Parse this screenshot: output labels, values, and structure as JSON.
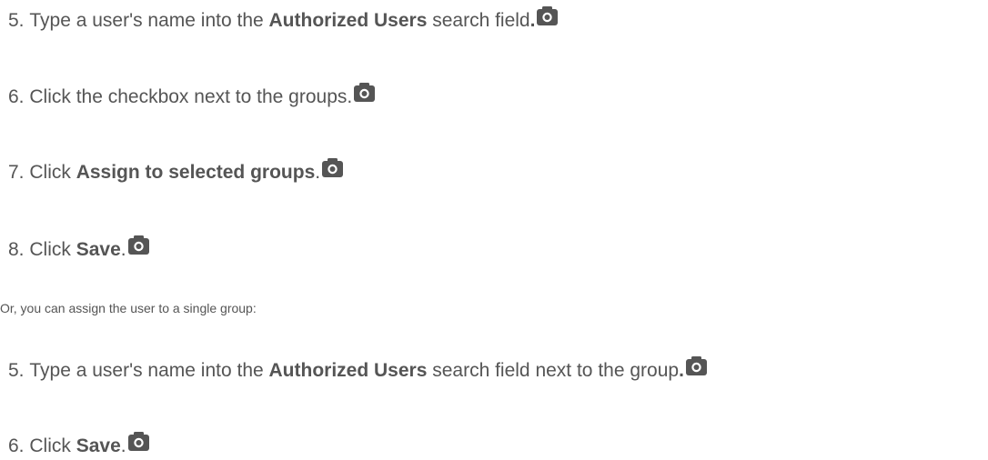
{
  "steps_group_a": [
    {
      "num": "5.",
      "pre": "Type a user's name into the ",
      "bold": "Authorized Users",
      "post": " search field",
      "tail_bold": ".",
      "icon": "camera-icon"
    },
    {
      "num": "6.",
      "pre": "Click the checkbox next to the groups.",
      "bold": "",
      "post": "",
      "tail_bold": "",
      "icon": "camera-icon"
    },
    {
      "num": "7.",
      "pre": "Click ",
      "bold": "Assign to selected groups",
      "post": ".",
      "tail_bold": "",
      "icon": "camera-icon"
    },
    {
      "num": "8.",
      "pre": "Click ",
      "bold": "Save",
      "post": ".",
      "tail_bold": "",
      "icon": "camera-icon"
    }
  ],
  "note": "Or, you can assign the user to a single group:",
  "steps_group_b": [
    {
      "num": "5.",
      "pre": "Type a user's name into the ",
      "bold": "Authorized Users",
      "post": " search field next to the group",
      "tail_bold": ".",
      "icon": "camera-icon"
    },
    {
      "num": "6.",
      "pre": "Click ",
      "bold": "Save",
      "post": ".",
      "tail_bold": "",
      "icon": "camera-icon"
    }
  ],
  "colors": {
    "text": "#555555",
    "icon": "#555555"
  }
}
